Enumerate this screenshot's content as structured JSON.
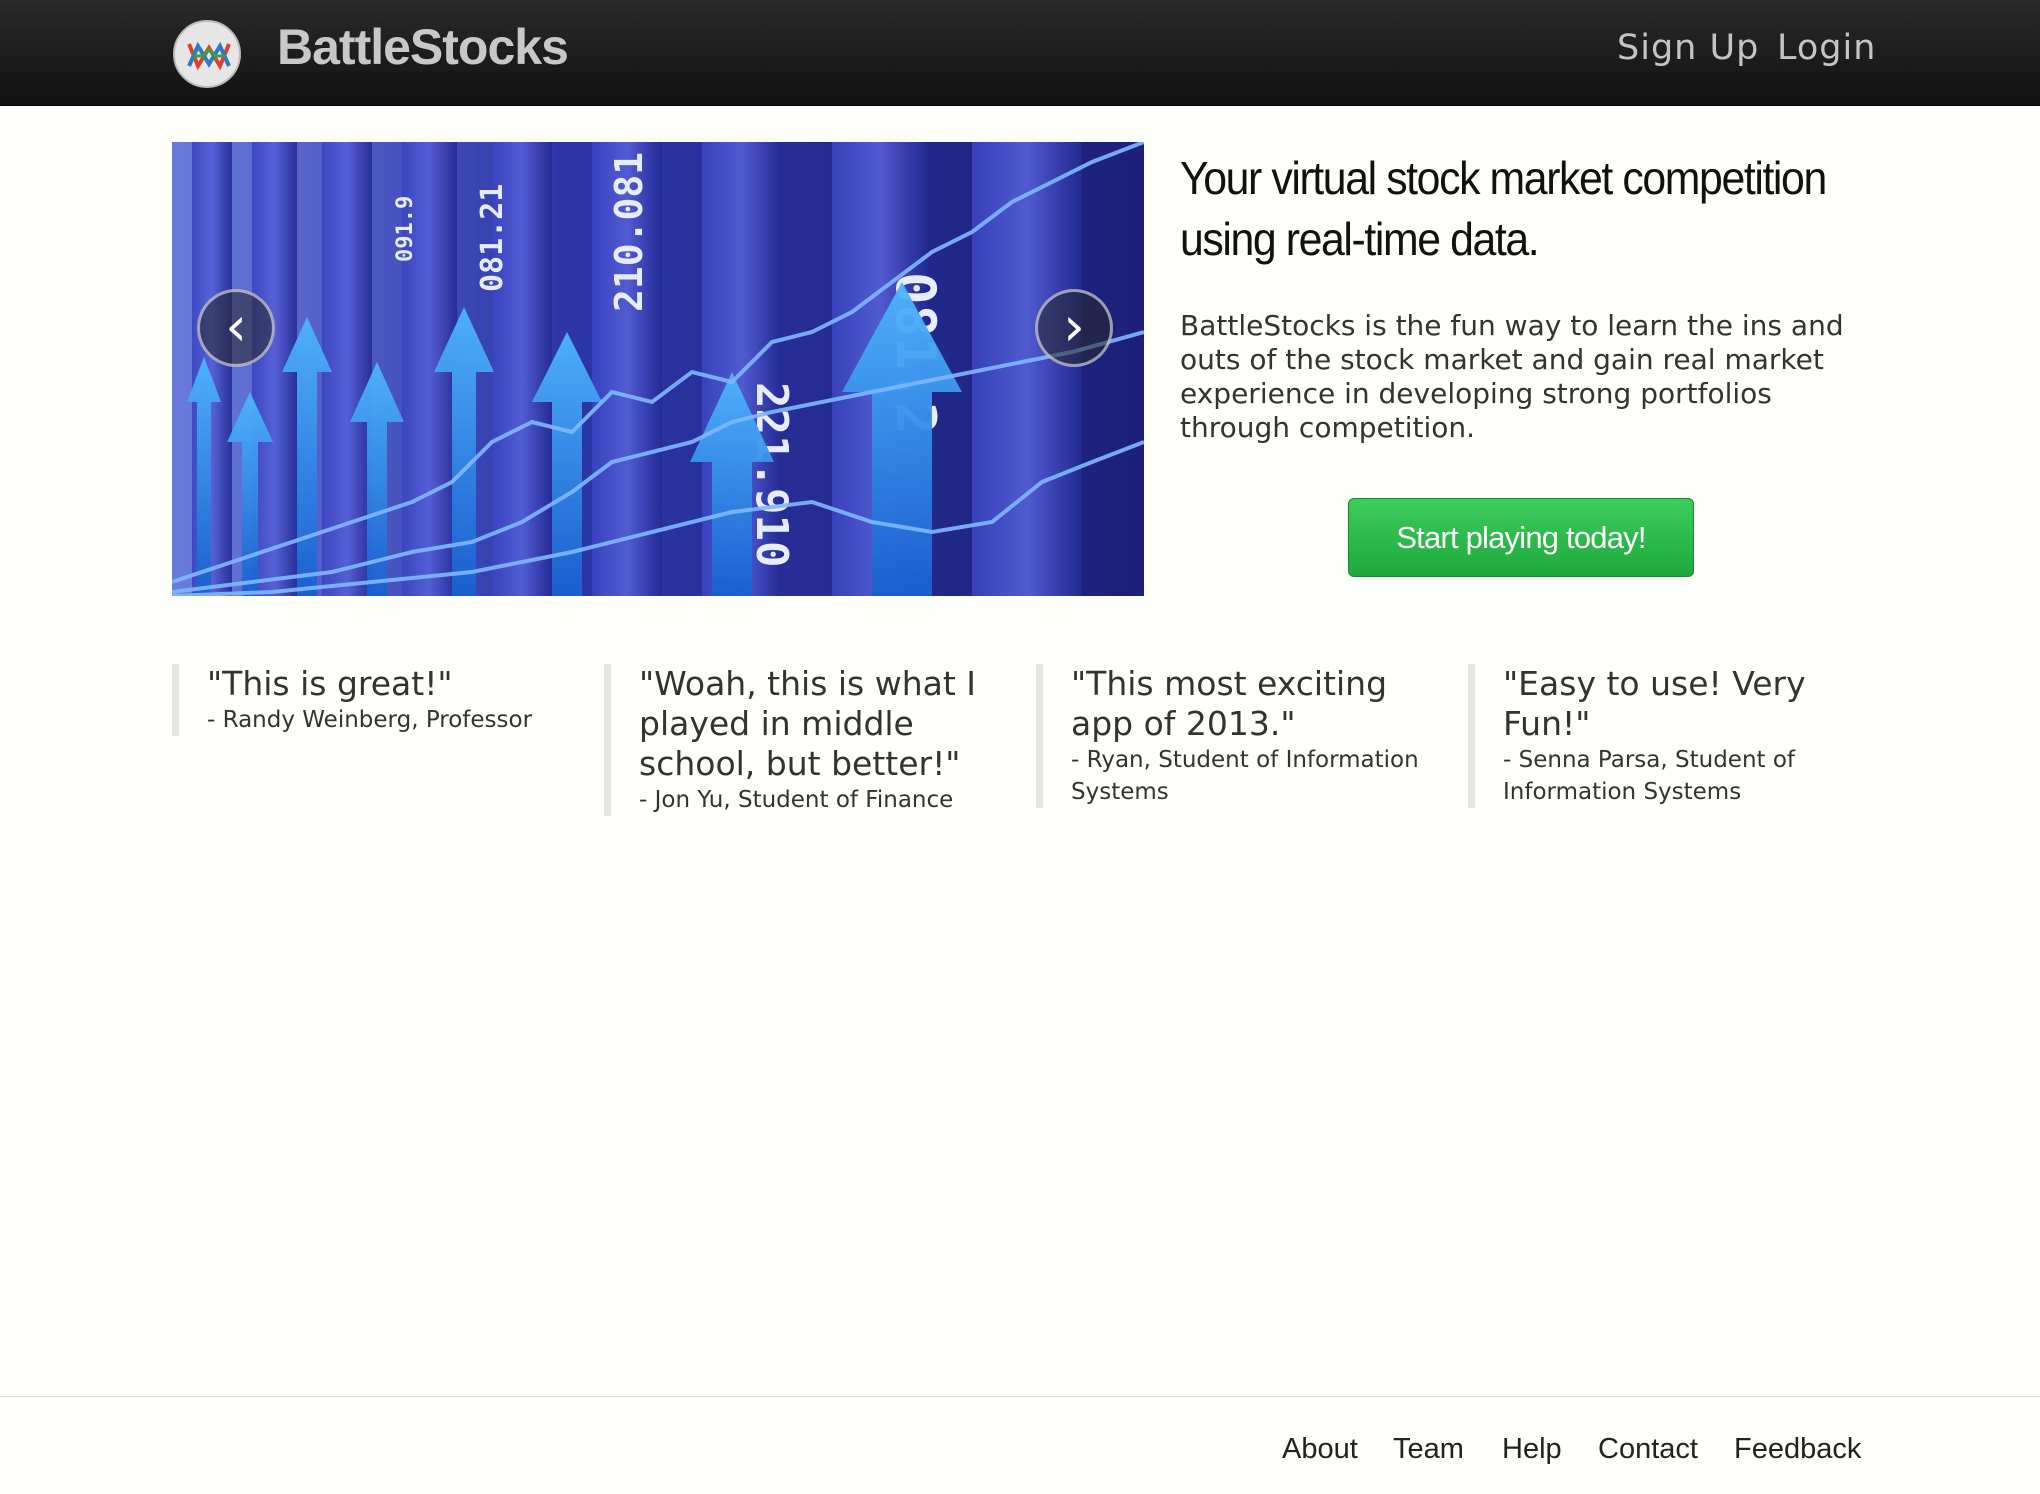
{
  "navbar": {
    "brand": "BattleStocks",
    "links": [
      "Sign Up",
      "Login"
    ]
  },
  "hero": {
    "headline": "Your virtual stock market competition using real-time data.",
    "lead": "BattleStocks is the fun way to learn the ins and outs of the stock market and gain real market experience in developing strong portfolios through competition.",
    "cta_label": "Start playing today!"
  },
  "carousel": {
    "prev_icon": "chevron-left-icon",
    "next_icon": "chevron-right-icon",
    "numbers": [
      "081.21",
      "210.081",
      "221.910",
      "081.2",
      "091.9"
    ]
  },
  "testimonials": [
    {
      "quote": "\"This is great!\"",
      "author": "- Randy Weinberg, Professor"
    },
    {
      "quote": "\"Woah, this is what I played in middle school, but better!\"",
      "author": "- Jon Yu, Student of Finance"
    },
    {
      "quote": "\"This most exciting app of 2013.\"",
      "author": "- Ryan, Student of Information Systems"
    },
    {
      "quote": "\"Easy to use! Very Fun!\"",
      "author": "- Senna Parsa, Student of Information Systems"
    }
  ],
  "footer": {
    "links": [
      "About",
      "Team",
      "Help",
      "Contact",
      "Feedback"
    ]
  },
  "colors": {
    "navbar": "#1a1a1a",
    "cta": "#2cb94a",
    "background": "#fefefa"
  }
}
